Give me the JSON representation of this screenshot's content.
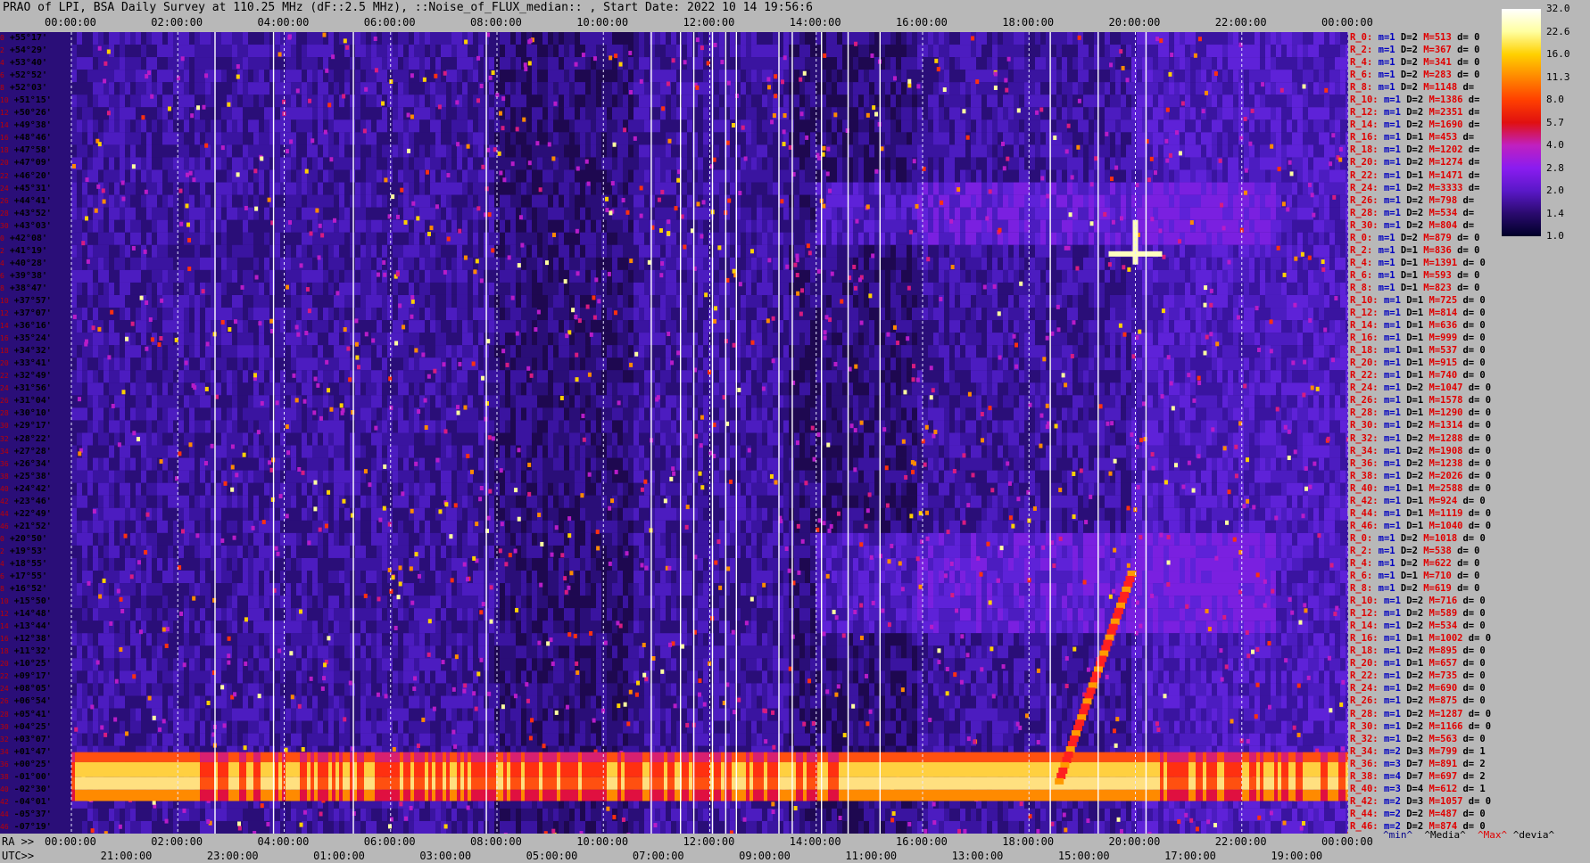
{
  "title": "PRAO of LPI, BSA Daily Survey at 110.25 MHz (dF::2.5 MHz), ::Noise_of_FLUX_median:: , Start Date: 2022 10 14 19:56:6",
  "chart_data": {
    "type": "heatmap",
    "top_axis_ticks": [
      "00:00:00",
      "02:00:00",
      "04:00:00",
      "06:00:00",
      "08:00:00",
      "10:00:00",
      "12:00:00",
      "14:00:00",
      "16:00:00",
      "18:00:00",
      "20:00:00",
      "22:00:00",
      "00:00:00"
    ],
    "ra_axis_label": "RA >>",
    "ra_axis_ticks": [
      "00:00:00",
      "02:00:00",
      "04:00:00",
      "06:00:00",
      "08:00:00",
      "10:00:00",
      "12:00:00",
      "14:00:00",
      "16:00:00",
      "18:00:00",
      "20:00:00",
      "22:00:00",
      "00:00:00"
    ],
    "utc_axis_label": "UTC>>",
    "utc_axis_ticks": [
      "21:00:00",
      "23:00:00",
      "01:00:00",
      "03:00:00",
      "05:00:00",
      "07:00:00",
      "09:00:00",
      "11:00:00",
      "13:00:00",
      "15:00:00",
      "17:00:00",
      "19:00:00"
    ],
    "colorbar_ticks": [
      "32.0",
      "22.6",
      "16.0",
      "11.3",
      "8.0",
      "5.7",
      "4.0",
      "2.8",
      "2.0",
      "1.4",
      "1.0"
    ],
    "colorbar_colors": [
      "#000028",
      "#2a0a6e",
      "#5a18c8",
      "#8a1cf0",
      "#c020c0",
      "#e01010",
      "#ff4000",
      "#ff8800",
      "#ffd000",
      "#ffffa0",
      "#ffffff"
    ],
    "declinations": [
      "+55°17'",
      "+54°29'",
      "+53°40'",
      "+52°52'",
      "+52°03'",
      "+51°15'",
      "+50°26'",
      "+49°38'",
      "+48°46'",
      "+47°58'",
      "+47°09'",
      "+46°20'",
      "+45°31'",
      "+44°41'",
      "+43°52'",
      "+43°03'",
      "+42°08'",
      "+41°19'",
      "+40°28'",
      "+39°38'",
      "+38°47'",
      "+37°57'",
      "+37°07'",
      "+36°16'",
      "+35°24'",
      "+34°32'",
      "+33°41'",
      "+32°49'",
      "+31°56'",
      "+31°04'",
      "+30°10'",
      "+29°17'",
      "+28°22'",
      "+27°28'",
      "+26°34'",
      "+25°38'",
      "+24°42'",
      "+23°46'",
      "+22°49'",
      "+21°52'",
      "+20°50'",
      "+19°53'",
      "+18°55'",
      "+17°55'",
      "+16°52'",
      "+15°50'",
      "+14°48'",
      "+13°44'",
      "+12°38'",
      "+11°32'",
      "+10°25'",
      "+09°17'",
      "+08°05'",
      "+06°54'",
      "+05°41'",
      "+04°25'",
      "+03°07'",
      "+01°47'",
      "+00°25'",
      "-01°00'",
      "-02°30'",
      "-04°01'",
      "-05°37'",
      "-07°19'"
    ],
    "row_indices": [
      "0",
      "2",
      "4",
      "6",
      "8",
      "10",
      "12",
      "14",
      "16",
      "18",
      "20",
      "22",
      "24",
      "26",
      "28",
      "30",
      "0",
      "2",
      "4",
      "6",
      "8",
      "10",
      "12",
      "14",
      "16",
      "18",
      "20",
      "22",
      "24",
      "26",
      "28",
      "30",
      "32",
      "34",
      "36",
      "38",
      "40",
      "42",
      "44",
      "46",
      "0",
      "2",
      "4",
      "6",
      "8",
      "10",
      "12",
      "14",
      "16",
      "18",
      "20",
      "22",
      "24",
      "26",
      "28",
      "30",
      "32",
      "34",
      "36",
      "38",
      "40",
      "42",
      "44",
      "46"
    ],
    "stats": [
      {
        "r": "R_0:",
        "m": "m=1",
        "d": "D=2",
        "mx": "M=513",
        "dv": "d= 0"
      },
      {
        "r": "R_2:",
        "m": "m=1",
        "d": "D=2",
        "mx": "M=367",
        "dv": "d= 0"
      },
      {
        "r": "R_4:",
        "m": "m=1",
        "d": "D=2",
        "mx": "M=341",
        "dv": "d= 0"
      },
      {
        "r": "R_6:",
        "m": "m=1",
        "d": "D=2",
        "mx": "M=283",
        "dv": "d= 0"
      },
      {
        "r": "R_8:",
        "m": "m=1",
        "d": "D=2",
        "mx": "M=1148",
        "dv": "d="
      },
      {
        "r": "R_10:",
        "m": "m=1",
        "d": "D=2",
        "mx": "M=1386",
        "dv": "d="
      },
      {
        "r": "R_12:",
        "m": "m=1",
        "d": "D=2",
        "mx": "M=2351",
        "dv": "d="
      },
      {
        "r": "R_14:",
        "m": "m=1",
        "d": "D=2",
        "mx": "M=1690",
        "dv": "d="
      },
      {
        "r": "R_16:",
        "m": "m=1",
        "d": "D=1",
        "mx": "M=453",
        "dv": "d="
      },
      {
        "r": "R_18:",
        "m": "m=1",
        "d": "D=2",
        "mx": "M=1202",
        "dv": "d="
      },
      {
        "r": "R_20:",
        "m": "m=1",
        "d": "D=2",
        "mx": "M=1274",
        "dv": "d="
      },
      {
        "r": "R_22:",
        "m": "m=1",
        "d": "D=1",
        "mx": "M=1471",
        "dv": "d="
      },
      {
        "r": "R_24:",
        "m": "m=1",
        "d": "D=2",
        "mx": "M=3333",
        "dv": "d="
      },
      {
        "r": "R_26:",
        "m": "m=1",
        "d": "D=2",
        "mx": "M=798",
        "dv": "d="
      },
      {
        "r": "R_28:",
        "m": "m=1",
        "d": "D=2",
        "mx": "M=534",
        "dv": "d="
      },
      {
        "r": "R_30:",
        "m": "m=1",
        "d": "D=2",
        "mx": "M=804",
        "dv": "d="
      },
      {
        "r": "R_0:",
        "m": "m=1",
        "d": "D=2",
        "mx": "M=879",
        "dv": "d= 0"
      },
      {
        "r": "R_2:",
        "m": "m=1",
        "d": "D=1",
        "mx": "M=836",
        "dv": "d= 0"
      },
      {
        "r": "R_4:",
        "m": "m=1",
        "d": "D=1",
        "mx": "M=1391",
        "dv": "d= 0"
      },
      {
        "r": "R_6:",
        "m": "m=1",
        "d": "D=1",
        "mx": "M=593",
        "dv": "d= 0"
      },
      {
        "r": "R_8:",
        "m": "m=1",
        "d": "D=1",
        "mx": "M=823",
        "dv": "d= 0"
      },
      {
        "r": "R_10:",
        "m": "m=1",
        "d": "D=1",
        "mx": "M=725",
        "dv": "d= 0"
      },
      {
        "r": "R_12:",
        "m": "m=1",
        "d": "D=1",
        "mx": "M=814",
        "dv": "d= 0"
      },
      {
        "r": "R_14:",
        "m": "m=1",
        "d": "D=1",
        "mx": "M=636",
        "dv": "d= 0"
      },
      {
        "r": "R_16:",
        "m": "m=1",
        "d": "D=1",
        "mx": "M=999",
        "dv": "d= 0"
      },
      {
        "r": "R_18:",
        "m": "m=1",
        "d": "D=1",
        "mx": "M=537",
        "dv": "d= 0"
      },
      {
        "r": "R_20:",
        "m": "m=1",
        "d": "D=1",
        "mx": "M=915",
        "dv": "d= 0"
      },
      {
        "r": "R_22:",
        "m": "m=1",
        "d": "D=1",
        "mx": "M=740",
        "dv": "d= 0"
      },
      {
        "r": "R_24:",
        "m": "m=1",
        "d": "D=2",
        "mx": "M=1047",
        "dv": "d= 0"
      },
      {
        "r": "R_26:",
        "m": "m=1",
        "d": "D=1",
        "mx": "M=1578",
        "dv": "d= 0"
      },
      {
        "r": "R_28:",
        "m": "m=1",
        "d": "D=1",
        "mx": "M=1290",
        "dv": "d= 0"
      },
      {
        "r": "R_30:",
        "m": "m=1",
        "d": "D=2",
        "mx": "M=1314",
        "dv": "d= 0"
      },
      {
        "r": "R_32:",
        "m": "m=1",
        "d": "D=2",
        "mx": "M=1288",
        "dv": "d= 0"
      },
      {
        "r": "R_34:",
        "m": "m=1",
        "d": "D=2",
        "mx": "M=1908",
        "dv": "d= 0"
      },
      {
        "r": "R_36:",
        "m": "m=1",
        "d": "D=2",
        "mx": "M=1238",
        "dv": "d= 0"
      },
      {
        "r": "R_38:",
        "m": "m=1",
        "d": "D=2",
        "mx": "M=2026",
        "dv": "d= 0"
      },
      {
        "r": "R_40:",
        "m": "m=1",
        "d": "D=1",
        "mx": "M=2588",
        "dv": "d= 0"
      },
      {
        "r": "R_42:",
        "m": "m=1",
        "d": "D=1",
        "mx": "M=924",
        "dv": "d= 0"
      },
      {
        "r": "R_44:",
        "m": "m=1",
        "d": "D=1",
        "mx": "M=1119",
        "dv": "d= 0"
      },
      {
        "r": "R_46:",
        "m": "m=1",
        "d": "D=1",
        "mx": "M=1040",
        "dv": "d= 0"
      },
      {
        "r": "R_0:",
        "m": "m=1",
        "d": "D=2",
        "mx": "M=1018",
        "dv": "d= 0"
      },
      {
        "r": "R_2:",
        "m": "m=1",
        "d": "D=2",
        "mx": "M=538",
        "dv": "d= 0"
      },
      {
        "r": "R_4:",
        "m": "m=1",
        "d": "D=2",
        "mx": "M=622",
        "dv": "d= 0"
      },
      {
        "r": "R_6:",
        "m": "m=1",
        "d": "D=1",
        "mx": "M=710",
        "dv": "d= 0"
      },
      {
        "r": "R_8:",
        "m": "m=1",
        "d": "D=2",
        "mx": "M=619",
        "dv": "d= 0"
      },
      {
        "r": "R_10:",
        "m": "m=1",
        "d": "D=2",
        "mx": "M=716",
        "dv": "d= 0"
      },
      {
        "r": "R_12:",
        "m": "m=1",
        "d": "D=2",
        "mx": "M=589",
        "dv": "d= 0"
      },
      {
        "r": "R_14:",
        "m": "m=1",
        "d": "D=2",
        "mx": "M=534",
        "dv": "d= 0"
      },
      {
        "r": "R_16:",
        "m": "m=1",
        "d": "D=1",
        "mx": "M=1002",
        "dv": "d= 0"
      },
      {
        "r": "R_18:",
        "m": "m=1",
        "d": "D=2",
        "mx": "M=895",
        "dv": "d= 0"
      },
      {
        "r": "R_20:",
        "m": "m=1",
        "d": "D=1",
        "mx": "M=657",
        "dv": "d= 0"
      },
      {
        "r": "R_22:",
        "m": "m=1",
        "d": "D=2",
        "mx": "M=735",
        "dv": "d= 0"
      },
      {
        "r": "R_24:",
        "m": "m=1",
        "d": "D=2",
        "mx": "M=690",
        "dv": "d= 0"
      },
      {
        "r": "R_26:",
        "m": "m=1",
        "d": "D=2",
        "mx": "M=875",
        "dv": "d= 0"
      },
      {
        "r": "R_28:",
        "m": "m=1",
        "d": "D=2",
        "mx": "M=1287",
        "dv": "d= 0"
      },
      {
        "r": "R_30:",
        "m": "m=1",
        "d": "D=2",
        "mx": "M=1166",
        "dv": "d= 0"
      },
      {
        "r": "R_32:",
        "m": "m=1",
        "d": "D=2",
        "mx": "M=563",
        "dv": "d= 0"
      },
      {
        "r": "R_34:",
        "m": "m=2",
        "d": "D=3",
        "mx": "M=799",
        "dv": "d= 1"
      },
      {
        "r": "R_36:",
        "m": "m=3",
        "d": "D=7",
        "mx": "M=891",
        "dv": "d= 2"
      },
      {
        "r": "R_38:",
        "m": "m=4",
        "d": "D=7",
        "mx": "M=697",
        "dv": "d= 2"
      },
      {
        "r": "R_40:",
        "m": "m=3",
        "d": "D=4",
        "mx": "M=612",
        "dv": "d= 1"
      },
      {
        "r": "R_42:",
        "m": "m=2",
        "d": "D=3",
        "mx": "M=1057",
        "dv": "d= 0"
      },
      {
        "r": "R_44:",
        "m": "m=2",
        "d": "D=2",
        "mx": "M=487",
        "dv": "d= 0"
      },
      {
        "r": "R_46:",
        "m": "m=2",
        "d": "D=2",
        "mx": "M=874",
        "dv": "d= 0"
      }
    ],
    "legend": {
      "min": "^min^",
      "median": "^Media^",
      "max": "^Max^",
      "devia": "^devia^"
    }
  }
}
